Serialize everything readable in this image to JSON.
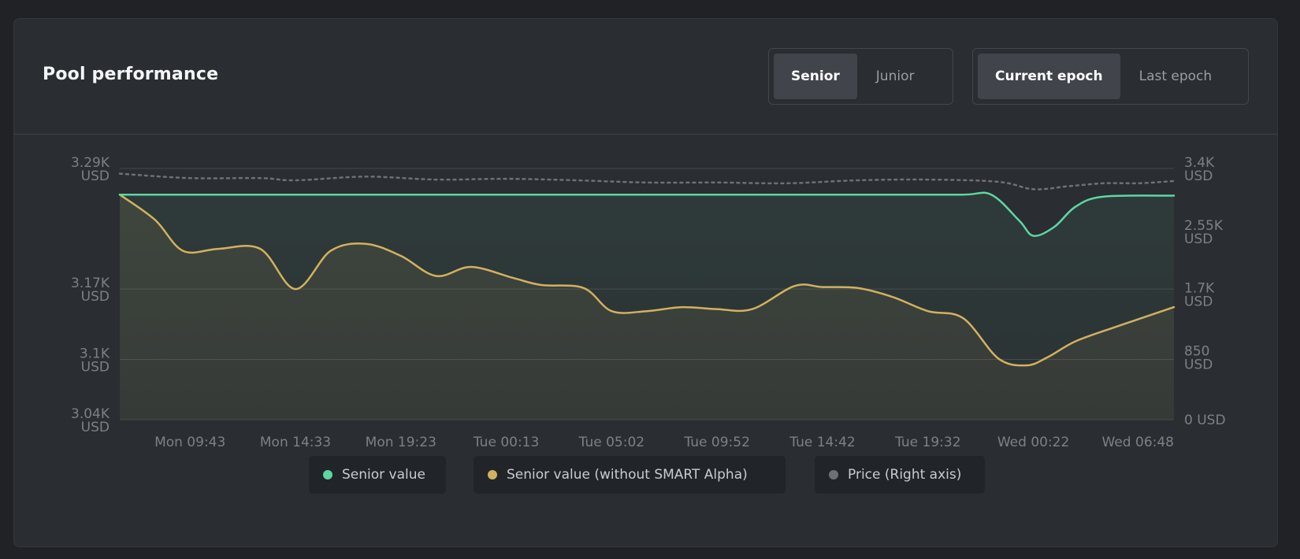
{
  "card": {
    "title": "Pool performance"
  },
  "tranche_toggle": {
    "options": [
      "Senior",
      "Junior"
    ],
    "selected": "Senior"
  },
  "epoch_toggle": {
    "options": [
      "Current epoch",
      "Last epoch"
    ],
    "selected": "Current epoch"
  },
  "legend": [
    {
      "label": "Senior value",
      "color": "#5fd6a0"
    },
    {
      "label": "Senior value (without SMART Alpha)",
      "color": "#d2b15f"
    },
    {
      "label": "Price (Right axis)",
      "color": "#6e7075"
    }
  ],
  "colors": {
    "senior_value": "#5fd6a0",
    "senior_value_without_smart_alpha": "#d2b15f",
    "price": "#6e7075",
    "grid": "#44474b",
    "axis_text": "#7d8085"
  },
  "chart_data": {
    "type": "line",
    "left_axis": {
      "ticks": [
        {
          "value": 3040,
          "label": "3.04K",
          "unit": "USD"
        },
        {
          "value": 3100,
          "label": "3.1K",
          "unit": "USD"
        },
        {
          "value": 3170,
          "label": "3.17K",
          "unit": "USD"
        },
        {
          "value": 3290,
          "label": "3.29K",
          "unit": "USD"
        }
      ],
      "ylim": [
        3040,
        3290
      ]
    },
    "right_axis": {
      "ticks": [
        {
          "value": 0,
          "label": "0 USD",
          "unit": ""
        },
        {
          "value": 850,
          "label": "850",
          "unit": "USD"
        },
        {
          "value": 1700,
          "label": "1.7K",
          "unit": "USD"
        },
        {
          "value": 2550,
          "label": "2.55K",
          "unit": "USD"
        },
        {
          "value": 3400,
          "label": "3.4K",
          "unit": "USD"
        }
      ],
      "ylim": [
        0,
        3400
      ]
    },
    "x_ticks": [
      {
        "t": 1.0,
        "label": "Mon 09:43"
      },
      {
        "t": 2.5,
        "label": "Mon 14:33"
      },
      {
        "t": 4.0,
        "label": "Mon 19:23"
      },
      {
        "t": 5.5,
        "label": "Tue 00:13"
      },
      {
        "t": 7.0,
        "label": "Tue 05:02"
      },
      {
        "t": 8.5,
        "label": "Tue 09:52"
      },
      {
        "t": 10.0,
        "label": "Tue 14:42"
      },
      {
        "t": 11.5,
        "label": "Tue 19:32"
      },
      {
        "t": 13.0,
        "label": "Wed 00:22"
      },
      {
        "t": 15.0,
        "label": "Wed 06:48"
      }
    ],
    "xlim": [
      0,
      15
    ],
    "series": [
      {
        "name": "Senior value",
        "axis": "left",
        "x": [
          0,
          1,
          2,
          3,
          4,
          5,
          6,
          7,
          8,
          9,
          10,
          11,
          12,
          12.4,
          12.8,
          13.0,
          13.3,
          13.6,
          14.0,
          15
        ],
        "values": [
          3264,
          3264,
          3264,
          3264,
          3264,
          3264,
          3264,
          3264,
          3264,
          3264,
          3264,
          3264,
          3264,
          3264,
          3238,
          3223,
          3232,
          3252,
          3262,
          3263
        ]
      },
      {
        "name": "Senior value (without SMART Alpha)",
        "axis": "left",
        "x": [
          0,
          0.5,
          0.9,
          1.4,
          2.0,
          2.5,
          3.0,
          3.5,
          4.0,
          4.5,
          5.0,
          5.6,
          6.0,
          6.6,
          7.0,
          7.5,
          8.0,
          8.5,
          9.0,
          9.6,
          10.0,
          10.5,
          11.0,
          11.5,
          12.0,
          12.5,
          12.9,
          13.2,
          13.6,
          14.2,
          15.0
        ],
        "values": [
          3264,
          3239,
          3208,
          3210,
          3210,
          3170,
          3208,
          3215,
          3203,
          3183,
          3192,
          3181,
          3174,
          3171,
          3148,
          3148,
          3152,
          3150,
          3150,
          3173,
          3172,
          3171,
          3162,
          3148,
          3141,
          3101,
          3094,
          3102,
          3118,
          3133,
          3152
        ]
      },
      {
        "name": "Price (Right axis)",
        "axis": "right",
        "x": [
          0,
          1,
          2,
          2.5,
          3.5,
          4.5,
          5.5,
          6.5,
          7.5,
          8.5,
          9.5,
          10.5,
          11.5,
          12.5,
          13.0,
          13.5,
          14.0,
          14.5,
          15.0
        ],
        "values": [
          3330,
          3270,
          3270,
          3240,
          3290,
          3250,
          3260,
          3240,
          3210,
          3210,
          3200,
          3240,
          3250,
          3220,
          3120,
          3160,
          3200,
          3200,
          3230
        ]
      }
    ],
    "grid": true,
    "legend_position": "bottom-center"
  }
}
